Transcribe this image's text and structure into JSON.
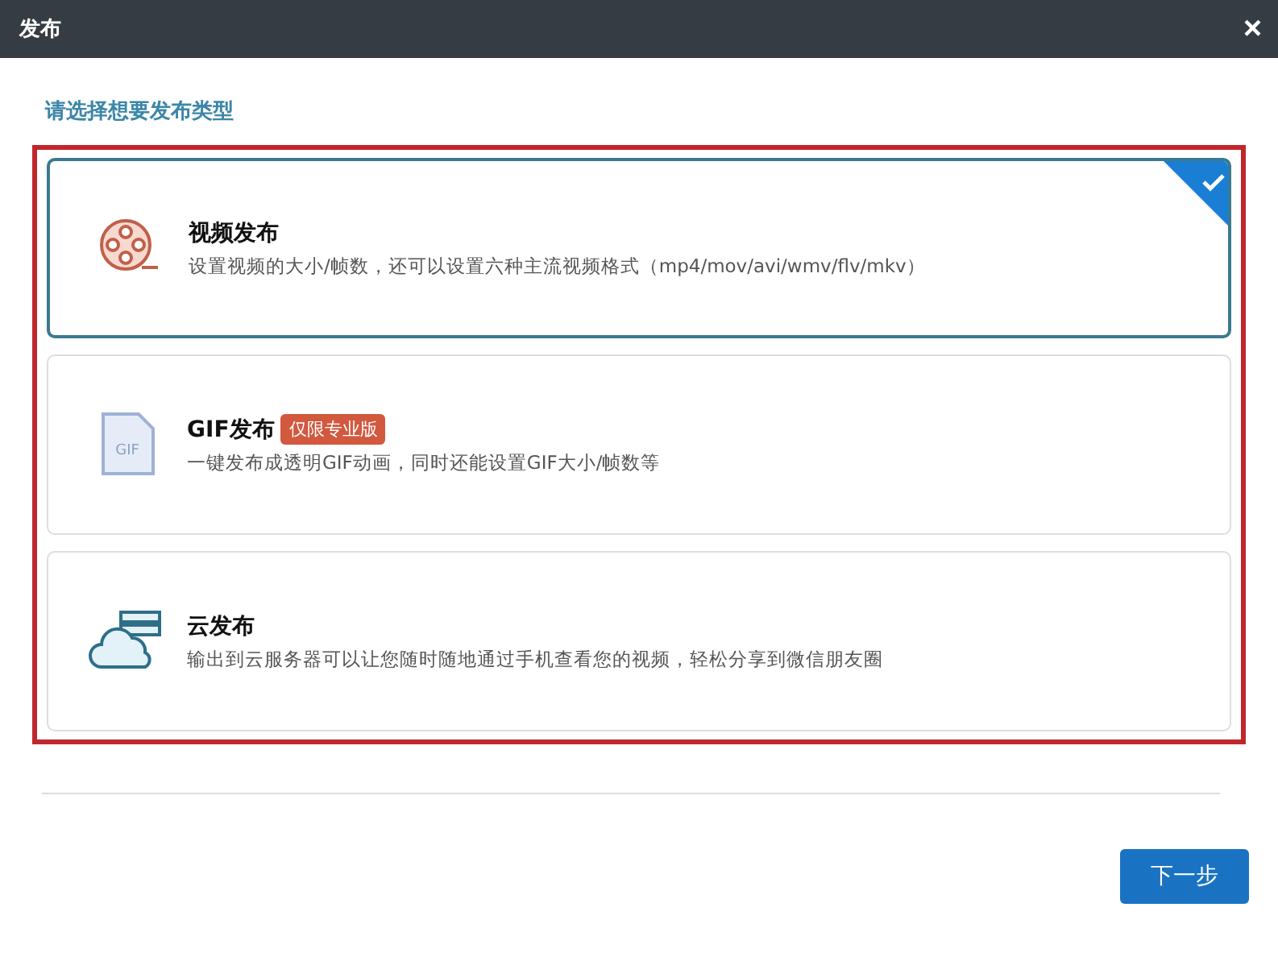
{
  "window": {
    "title": "发布",
    "close": "×"
  },
  "prompt": "请选择想要发布类型",
  "options": [
    {
      "kind": "video",
      "title": "视频发布",
      "description": "设置视频的大小/帧数，还可以设置六种主流视频格式（mp4/mov/avi/wmv/flv/mkv）",
      "selected": true
    },
    {
      "kind": "gif",
      "icon_text": "GIF",
      "title": "GIF发布",
      "badge": "仅限专业版",
      "description": "一键发布成透明GIF动画，同时还能设置GIF大小/帧数等",
      "selected": false
    },
    {
      "kind": "cloud",
      "title": "云发布",
      "description": "输出到云服务器可以让您随时随地通过手机查看您的视频，轻松分享到微信朋友圈",
      "selected": false
    }
  ],
  "buttons": [
    "下一步"
  ]
}
